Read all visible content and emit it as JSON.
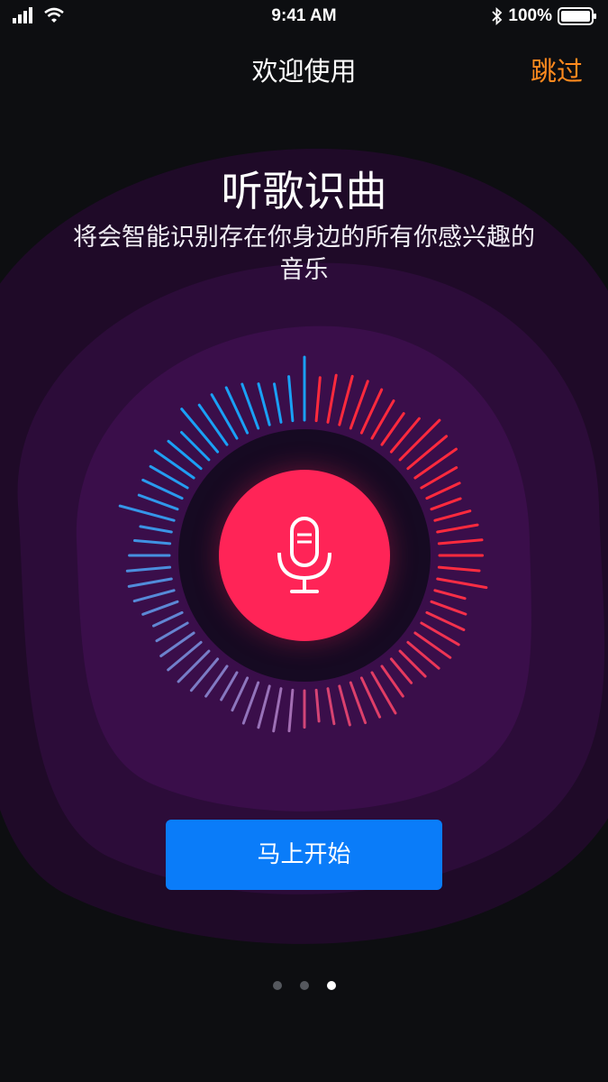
{
  "status_bar": {
    "time": "9:41 AM",
    "battery": "100%",
    "icons": [
      "signal-icon",
      "wifi-icon",
      "bluetooth-icon",
      "battery-icon"
    ]
  },
  "nav": {
    "title": "欢迎使用",
    "skip_label": "跳过"
  },
  "hero": {
    "title": "听歌识曲",
    "subtitle": "将会智能识别存在你身边的所有你感兴趣的音乐"
  },
  "mic": {
    "icon": "microphone-icon"
  },
  "cta": {
    "label": "马上开始"
  },
  "pagination": {
    "count": 3,
    "active_index": 2
  },
  "colors": {
    "background": "#0d0e11",
    "accent_orange": "#ff8a1e",
    "mic_red": "#ff2457",
    "button_blue": "#0a7cf9",
    "wave_blue": "#1e9ff0",
    "wave_red": "#ff2a3d",
    "glow_purple": "#3e0f4a"
  }
}
